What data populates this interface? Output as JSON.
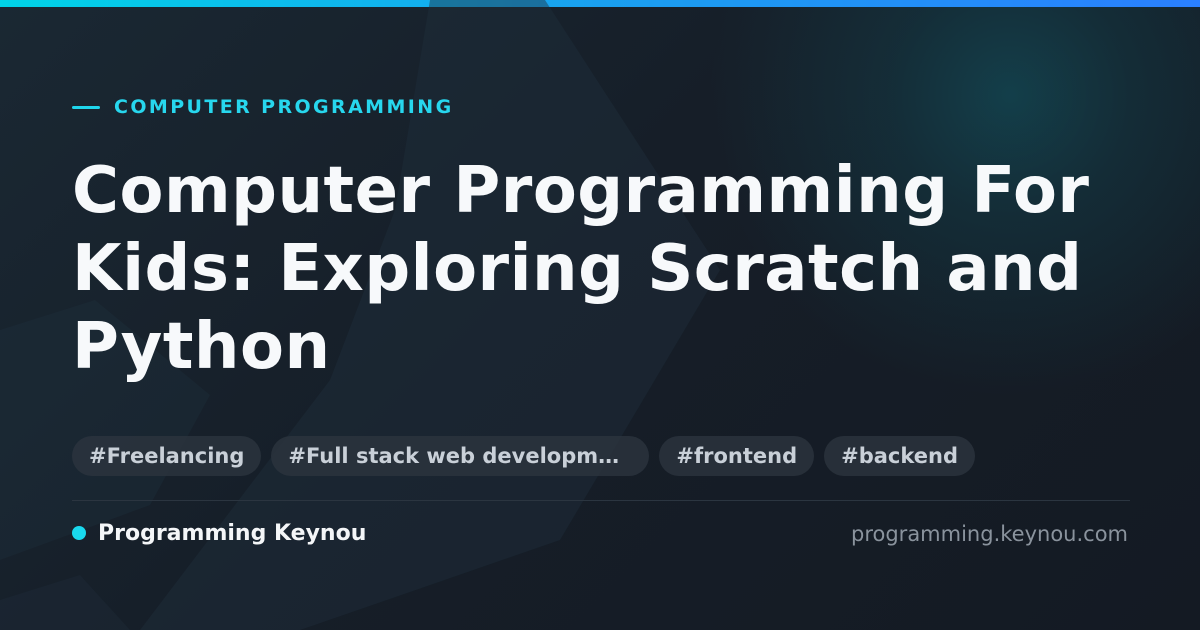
{
  "card": {
    "eyebrow": "COMPUTER PROGRAMMING",
    "title": "Computer Programming For Kids: Exploring Scratch and Python",
    "tags": [
      "#Freelancing",
      "#Full stack web development",
      "#frontend",
      "#backend"
    ],
    "brand_name": "Programming Keynou",
    "site_url": "programming.keynou.com"
  },
  "colors": {
    "accent": "#1fd6ec",
    "background": "#151b24",
    "title": "#f7f9fb",
    "tag_background": "#2c343f",
    "tag_text": "#c9d0d8",
    "url_text": "#8a939d"
  },
  "icons": {
    "brand_marker": "dot-icon",
    "eyebrow_marker": "dash-icon"
  }
}
